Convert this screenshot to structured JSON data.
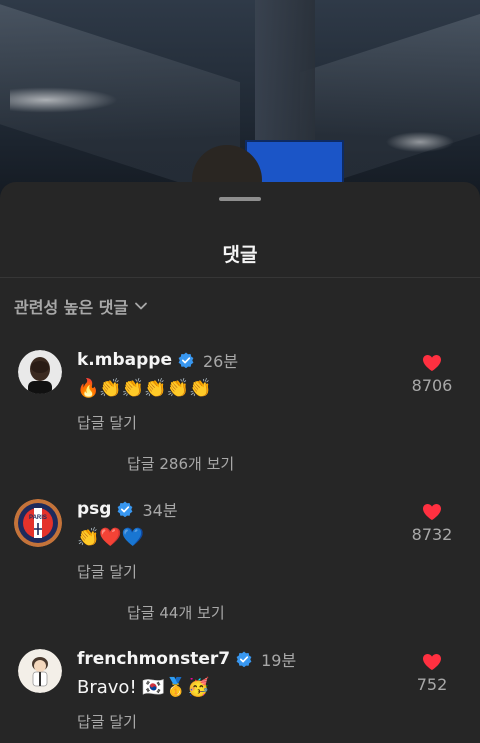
{
  "sheet": {
    "title": "댓글",
    "sort_label": "관련성 높은 댓글"
  },
  "comments": [
    {
      "username": "k.mbappe",
      "verified": true,
      "time": "26분",
      "text": "🔥👏👏👏👏👏",
      "reply_label": "답글 달기",
      "view_replies": "답글 286개 보기",
      "likes": "8706",
      "avatar_icon": "player-portrait"
    },
    {
      "username": "psg",
      "verified": true,
      "time": "34분",
      "text": "👏❤️💙",
      "reply_label": "답글 달기",
      "view_replies": "답글 44개 보기",
      "likes": "8732",
      "avatar_icon": "psg-crest",
      "avatar_text": "PARIS"
    },
    {
      "username": "frenchmonster7",
      "verified": true,
      "time": "19분",
      "text": "Bravo! 🇰🇷🥇🥳",
      "reply_label": "답글 달기",
      "likes": "752",
      "avatar_icon": "cartoon-character"
    }
  ],
  "colors": {
    "sheet_bg": "#262626",
    "heart": "#ff3040",
    "verified": "#3897f0",
    "secondary_text": "#a8a8a8"
  }
}
